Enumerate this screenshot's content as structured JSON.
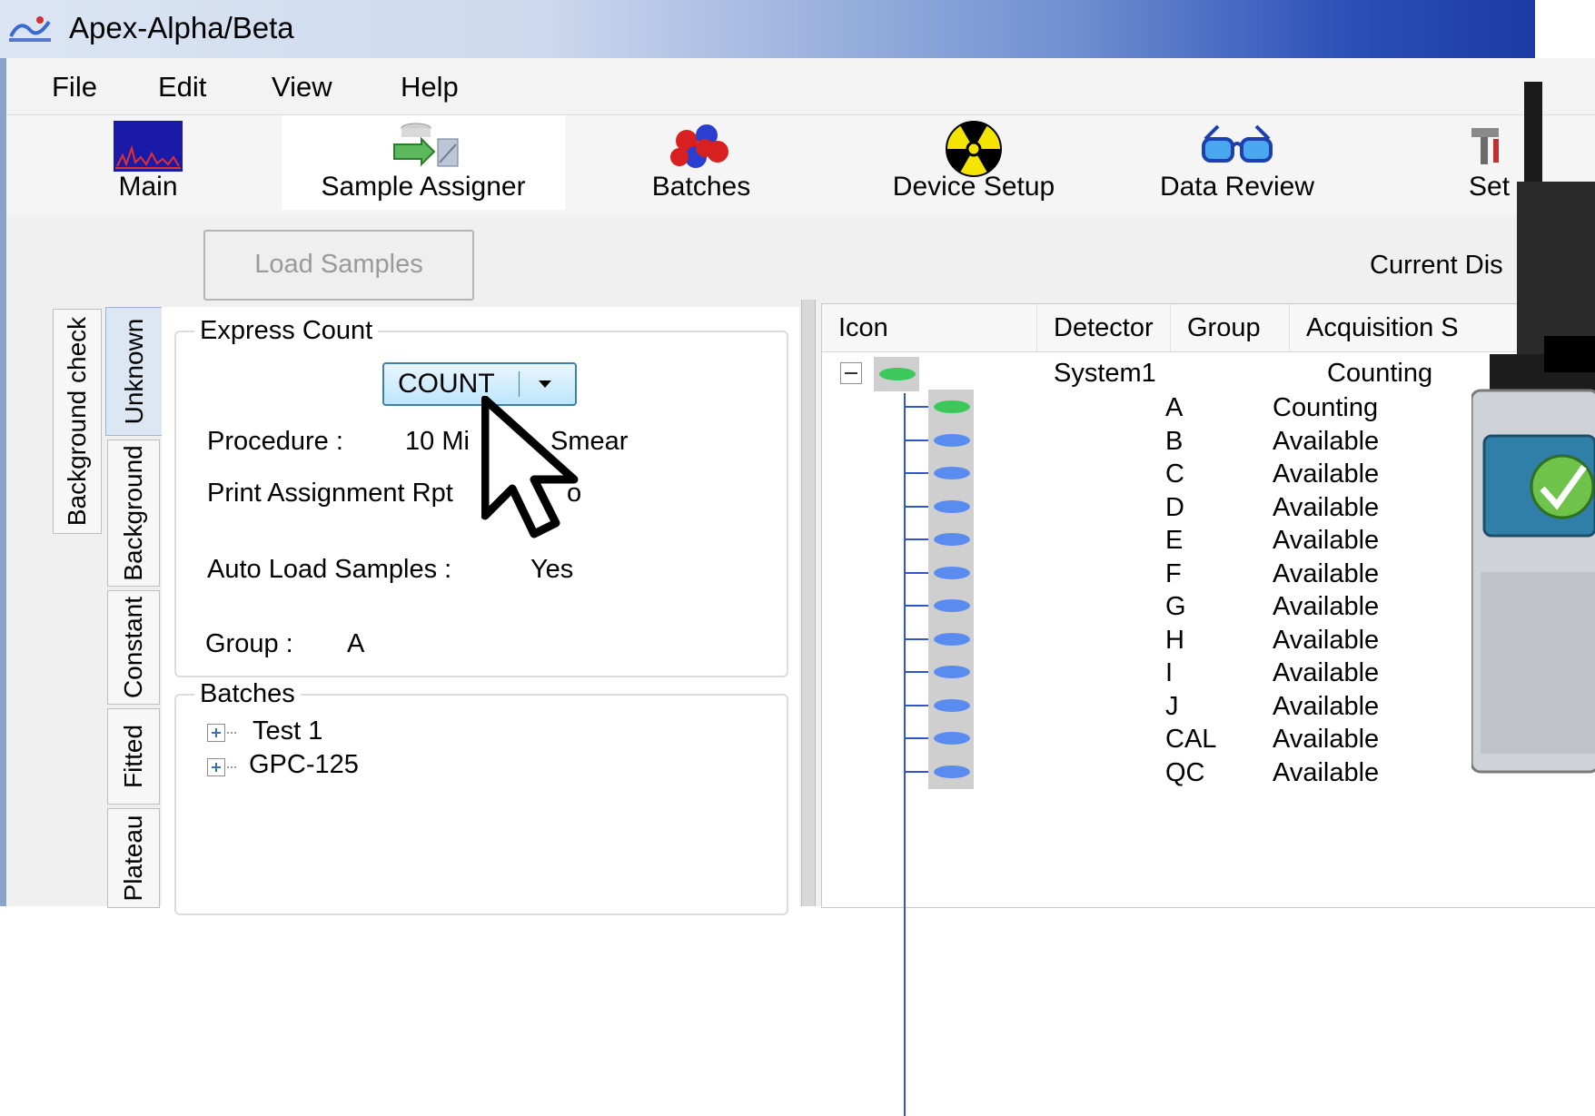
{
  "window": {
    "title": "Apex-Alpha/Beta"
  },
  "menu": [
    "File",
    "Edit",
    "View",
    "Help"
  ],
  "toolbar": {
    "items": [
      {
        "label": "Main",
        "icon": "spectrum-chart-icon"
      },
      {
        "label": "Sample Assigner",
        "icon": "sample-assigner-icon",
        "selected": true
      },
      {
        "label": "Batches",
        "icon": "atom-cluster-icon"
      },
      {
        "label": "Device Setup",
        "icon": "radiation-icon"
      },
      {
        "label": "Data Review",
        "icon": "glasses-icon"
      },
      {
        "label": "Set",
        "icon": "tools-icon"
      }
    ]
  },
  "load_samples_label": "Load Samples",
  "current_display_label": "Current Dis",
  "vertical_tabs": {
    "outer": [
      "Background check"
    ],
    "inner": [
      "Unknown",
      "Background",
      "Constant",
      "Fitted",
      "Plateau"
    ],
    "active": "Unknown"
  },
  "express_count": {
    "title": "Express Count",
    "button_label": "COUNT",
    "procedure_label": "Procedure :",
    "procedure_value": "10 Mi",
    "procedure_value_tail": "Smear",
    "print_label": "Print Assignment Rpt",
    "print_value": "o",
    "autoload_label": "Auto Load Samples :",
    "autoload_value": "Yes",
    "group_label": "Group :",
    "group_value": "A"
  },
  "batches": {
    "title": "Batches",
    "items": [
      "Test 1",
      "GPC-125"
    ]
  },
  "grid": {
    "columns": [
      "Icon",
      "Detector",
      "Group",
      "Acquisition S"
    ],
    "root": {
      "detector": "System1",
      "status": "Counting"
    },
    "rows": [
      {
        "group": "A",
        "status": "Counting",
        "color": "#3cc85a"
      },
      {
        "group": "B",
        "status": "Available",
        "color": "#5a8cf0"
      },
      {
        "group": "C",
        "status": "Available",
        "color": "#5a8cf0"
      },
      {
        "group": "D",
        "status": "Available",
        "color": "#5a8cf0"
      },
      {
        "group": "E",
        "status": "Available",
        "color": "#5a8cf0"
      },
      {
        "group": "F",
        "status": "Available",
        "color": "#5a8cf0"
      },
      {
        "group": "G",
        "status": "Available",
        "color": "#5a8cf0"
      },
      {
        "group": "H",
        "status": "Available",
        "color": "#5a8cf0"
      },
      {
        "group": "I",
        "status": "Available",
        "color": "#5a8cf0"
      },
      {
        "group": "J",
        "status": "Available",
        "color": "#5a8cf0"
      },
      {
        "group": "CAL",
        "status": "Available",
        "color": "#5a8cf0"
      },
      {
        "group": "QC",
        "status": "Available",
        "color": "#5a8cf0"
      }
    ]
  },
  "colors": {
    "accent": "#3c7fb1",
    "counting": "#3cc85a",
    "available": "#5a8cf0"
  }
}
